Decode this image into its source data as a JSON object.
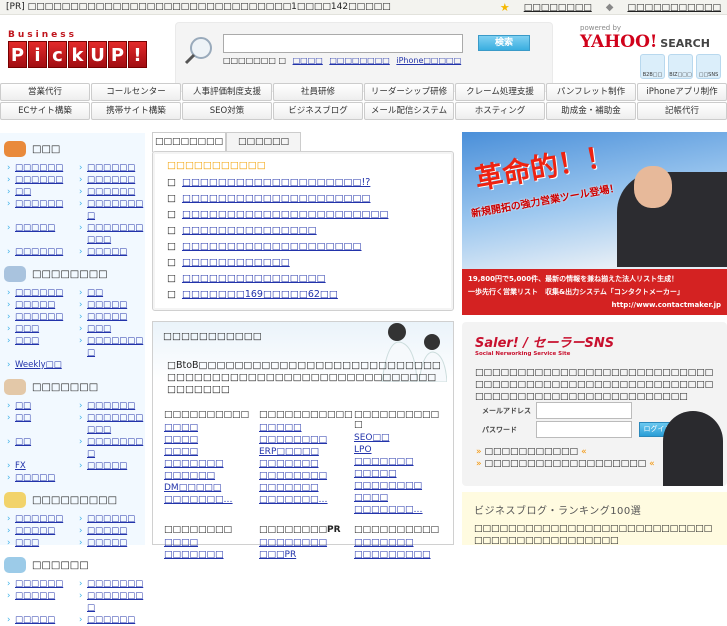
{
  "topbar": {
    "pr": "[PR] □□□□□□□□□□□□□□□□□□□□□□□□□□□□□□□1□□□□142□□□□□",
    "links": [
      "□□□□□□□□",
      "□□□□□□□□□□□"
    ]
  },
  "logo": {
    "top": "Business",
    "letters": [
      "P",
      "i",
      "c",
      "k",
      "U",
      "P",
      "!"
    ]
  },
  "search": {
    "button": "検索",
    "prefix": "□□□□□□□ □",
    "links": [
      "□□□□",
      "□□□□□□□□",
      "iPhone□□□□□"
    ],
    "value": ""
  },
  "yahoo": {
    "powered": "powered by",
    "brand": "YAHOO!",
    "search": "SEARCH",
    "icons": [
      "B2B□□",
      "BIZ□□□",
      "□□SNS"
    ]
  },
  "nav": [
    [
      "営業代行",
      "コールセンター",
      "人事評価制度支援",
      "社員研修",
      "リーダーシップ研修",
      "クレーム処理支援",
      "パンフレット制作",
      "iPhoneアプリ制作"
    ],
    [
      "ECサイト構築",
      "携帯サイト構築",
      "SEO対策",
      "ビジネスブログ",
      "メール配信システム",
      "ホスティング",
      "助成金・補助金",
      "記帳代行"
    ]
  ],
  "sidebar": [
    {
      "title": "□□□",
      "color": "#e98a3b",
      "items": [
        "□□□□□□",
        "□□□□□□",
        "□□□□□□",
        "□□□□□□",
        "□□",
        "□□□□□□",
        "□□□□□□",
        "□□□□□□□□",
        "□□□□□",
        "□□□□□□□□□□",
        "□□□□□□",
        "□□□□□"
      ]
    },
    {
      "title": "□□□□□□□□",
      "color": "#a9c3de",
      "items": [
        "□□□□□□",
        "□□",
        "□□□□□",
        "□□□□□",
        "□□□□□□",
        "□□□□□",
        "□□□",
        "□□□",
        "□□□",
        "□□□□□□□□",
        "Weekly□□"
      ]
    },
    {
      "title": "□□□□□□□",
      "color": "#e3c8a8",
      "items": [
        "□□",
        "□□□□□□",
        "□□",
        "□□□□□□□□□□",
        "□□",
        "□□□□□□□□",
        "FX",
        "□□□□□",
        "□□□□□"
      ]
    },
    {
      "title": "□□□□□□□□□",
      "color": "#f2d36b",
      "items": [
        "□□□□□□",
        "□□□□□□",
        "□□□□□",
        "□□□□□",
        "□□□",
        "□□□□□"
      ]
    },
    {
      "title": "□□□□□□",
      "color": "#9ccbe8",
      "items": [
        "□□□□□□",
        "□□□□□□□",
        "□□□□□",
        "□□□□□□□□",
        "□□□□□",
        "□□□□□□"
      ]
    }
  ],
  "tabs": [
    "□□□□□□□□",
    "□□□□□□"
  ],
  "news": {
    "heading": "□□□□□□□□□□□",
    "items": [
      "□□□□□□□□□□□□□□□□□□□□!?",
      "□□□□□□□□□□□□□□□□□□□□□",
      "□□□□□□□□□□□□□□□□□□□□□□□",
      "□□□□□□□□□□□□□□□",
      "□□□□□□□□□□□□□□□□□□□□",
      "□□□□□□□□□□□□",
      "□□□□□□□□□□□□□□□□",
      "□□□□□□□169□□□□□62□□"
    ]
  },
  "categories": {
    "title": "□□□□□□□□□□□",
    "desc": "□BtoB□□□□□□□□□□□□□□□□□□□□□□□□□□□□□□□□□□□□□□□□□□□□□□□□□□□□□□□□□□□□□□□□",
    "cols": [
      {
        "heading": "□□□□□□□□□□",
        "links": [
          "□□□□",
          "□□□□",
          "□□□□",
          "□□□□□□□",
          "□□□□□□",
          "DM□□□□□",
          "□□□□□□□…"
        ]
      },
      {
        "heading": "□□□□□□□□□□□",
        "links": [
          "□□□□□",
          "□□□□□□□□",
          "ERP□□□□□",
          "□□□□□□□",
          "□□□□□□□□",
          "□□□□□□□",
          "□□□□□□□…"
        ]
      },
      {
        "heading": "□□□□□□□□□□□",
        "links": [
          "SEO□□",
          "LPO",
          "□□□□□□□",
          "□□□□□",
          "□□□□□□□□",
          "□□□□",
          "□□□□□□□…"
        ]
      }
    ],
    "cols2": [
      {
        "heading": "□□□□□□□□",
        "links": [
          "□□□□",
          "□□□□□□□"
        ]
      },
      {
        "heading": "□□□□□□□□PR",
        "links": [
          "□□□□□□□□",
          "□□□PR"
        ]
      },
      {
        "heading": "□□□□□□□□□□",
        "links": [
          "□□□□□□□",
          "□□□□□□□□□"
        ]
      }
    ]
  },
  "banner": {
    "headline": "革命的！！",
    "sub": "新規開拓の強力営業ツール登場！",
    "line1": "19,800円で5,000件、最新の情報を兼ね揃えた法人リスト生成！",
    "line2": "一歩先行く営業リスト　収集&出力システム「コンタクトメーカー」",
    "url": "http://www.contactmaker.jp"
  },
  "saler": {
    "logo": "Saler! / セーラーSNS",
    "tagline": "Social Nerworking Service Site",
    "desc": "□□□□□□□□□□□□□□□□□□□□□□□□□□□□□□□□□□□□□□□□□□□□□□□□□□□□□□□□□□□□□□□□□□□□□□□□□□□□□□□□□",
    "email_label": "メールアドレス",
    "password_label": "パスワード",
    "login": "ログイン",
    "link1": "□□□□□□□□□□□",
    "link2": "□□□□□□□□□□□□□□□□□□□"
  },
  "blog": {
    "title": "ビジネスブログ・ランキング100選",
    "desc": "□□□□□□□□□□□□□□□□□□□□□□□□□□□□□□□□□□□□□□□□□□□□□"
  }
}
